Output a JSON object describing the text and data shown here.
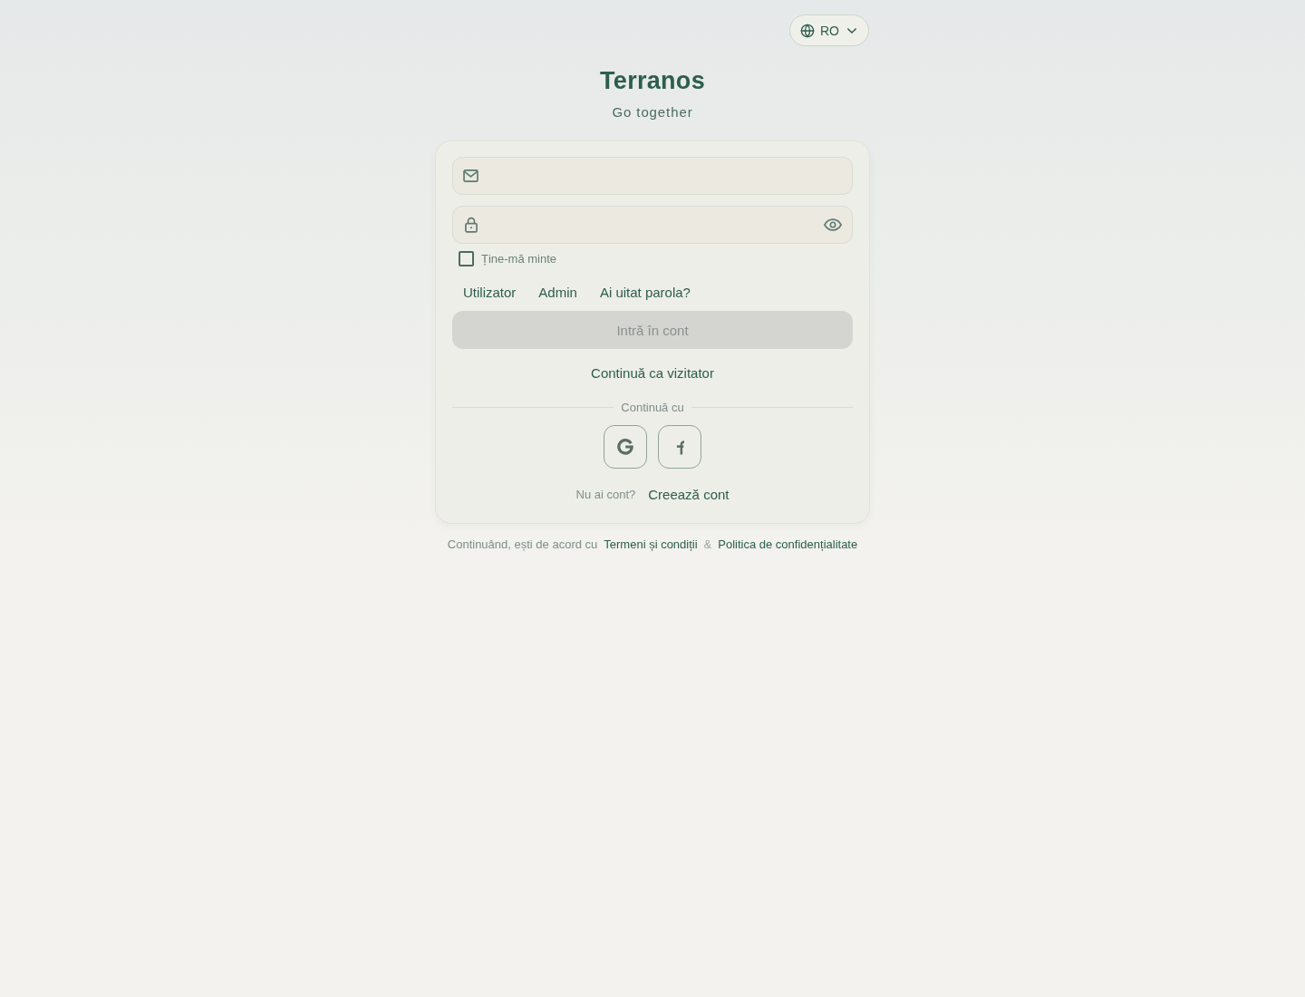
{
  "language_selector": {
    "code": "RO"
  },
  "brand": {
    "title": "Terranos",
    "tagline": "Go together"
  },
  "login_form": {
    "fields": [
      {
        "kind": "email",
        "reveal_toggle": false
      },
      {
        "kind": "password",
        "reveal_toggle": true
      }
    ],
    "remember_me": {
      "label": "Ține-mă minte",
      "checked": false
    },
    "links": [
      "Utilizator",
      "Admin",
      "Ai uitat parola?"
    ],
    "submit_button": {
      "label": "Intră în cont",
      "disabled": true
    },
    "guest_link": "Continuă ca vizitator",
    "divider_label": "Continuă cu",
    "social_buttons": [
      {
        "kind": "google"
      },
      {
        "kind": "facebook"
      }
    ],
    "signup_prompt": {
      "text": "Nu ai cont?",
      "link": "Creează cont"
    }
  },
  "legal_notice": {
    "text": "Continuând, ești de acord cu",
    "links": [
      "Termeni și condiții",
      "Politica de confidențialitate"
    ],
    "separator": "&"
  }
}
